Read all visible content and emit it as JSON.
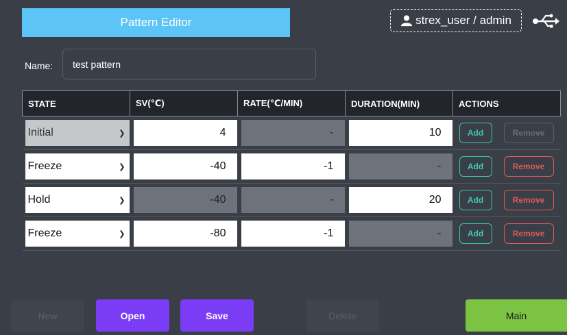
{
  "header": {
    "title": "Pattern Editor",
    "user": "strex_user / admin"
  },
  "name_field": {
    "label": "Name:",
    "value": "test pattern"
  },
  "table": {
    "columns": [
      "STATE",
      "SV(℃)",
      "RATE(℃/MIN)",
      "DURATION(MIN)",
      "ACTIONS"
    ],
    "rows": [
      {
        "state": "Initial",
        "state_disabled": true,
        "sv": "4",
        "sv_disabled": false,
        "rate": "-",
        "rate_disabled": true,
        "duration": "10",
        "duration_disabled": false,
        "remove_disabled": true
      },
      {
        "state": "Freeze",
        "state_disabled": false,
        "sv": "-40",
        "sv_disabled": false,
        "rate": "-1",
        "rate_disabled": false,
        "duration": "-",
        "duration_disabled": true,
        "remove_disabled": false
      },
      {
        "state": "Hold",
        "state_disabled": false,
        "sv": "-40",
        "sv_disabled": true,
        "rate": "-",
        "rate_disabled": true,
        "duration": "20",
        "duration_disabled": false,
        "remove_disabled": false
      },
      {
        "state": "Freeze",
        "state_disabled": false,
        "sv": "-80",
        "sv_disabled": false,
        "rate": "-1",
        "rate_disabled": false,
        "duration": "-",
        "duration_disabled": true,
        "remove_disabled": false
      }
    ],
    "add_label": "Add",
    "remove_label": "Remove"
  },
  "buttons": {
    "new": "New",
    "open": "Open",
    "save": "Save",
    "delete": "Delete",
    "main": "Main"
  },
  "colors": {
    "background": "#3a3e46",
    "title_bar": "#5cc4f6",
    "primary": "#7b3cf6",
    "main": "#7cc243",
    "add": "#3bc9b0",
    "remove": "#e05a5a"
  },
  "icons": {
    "user": "user-icon",
    "usb": "usb-icon"
  }
}
